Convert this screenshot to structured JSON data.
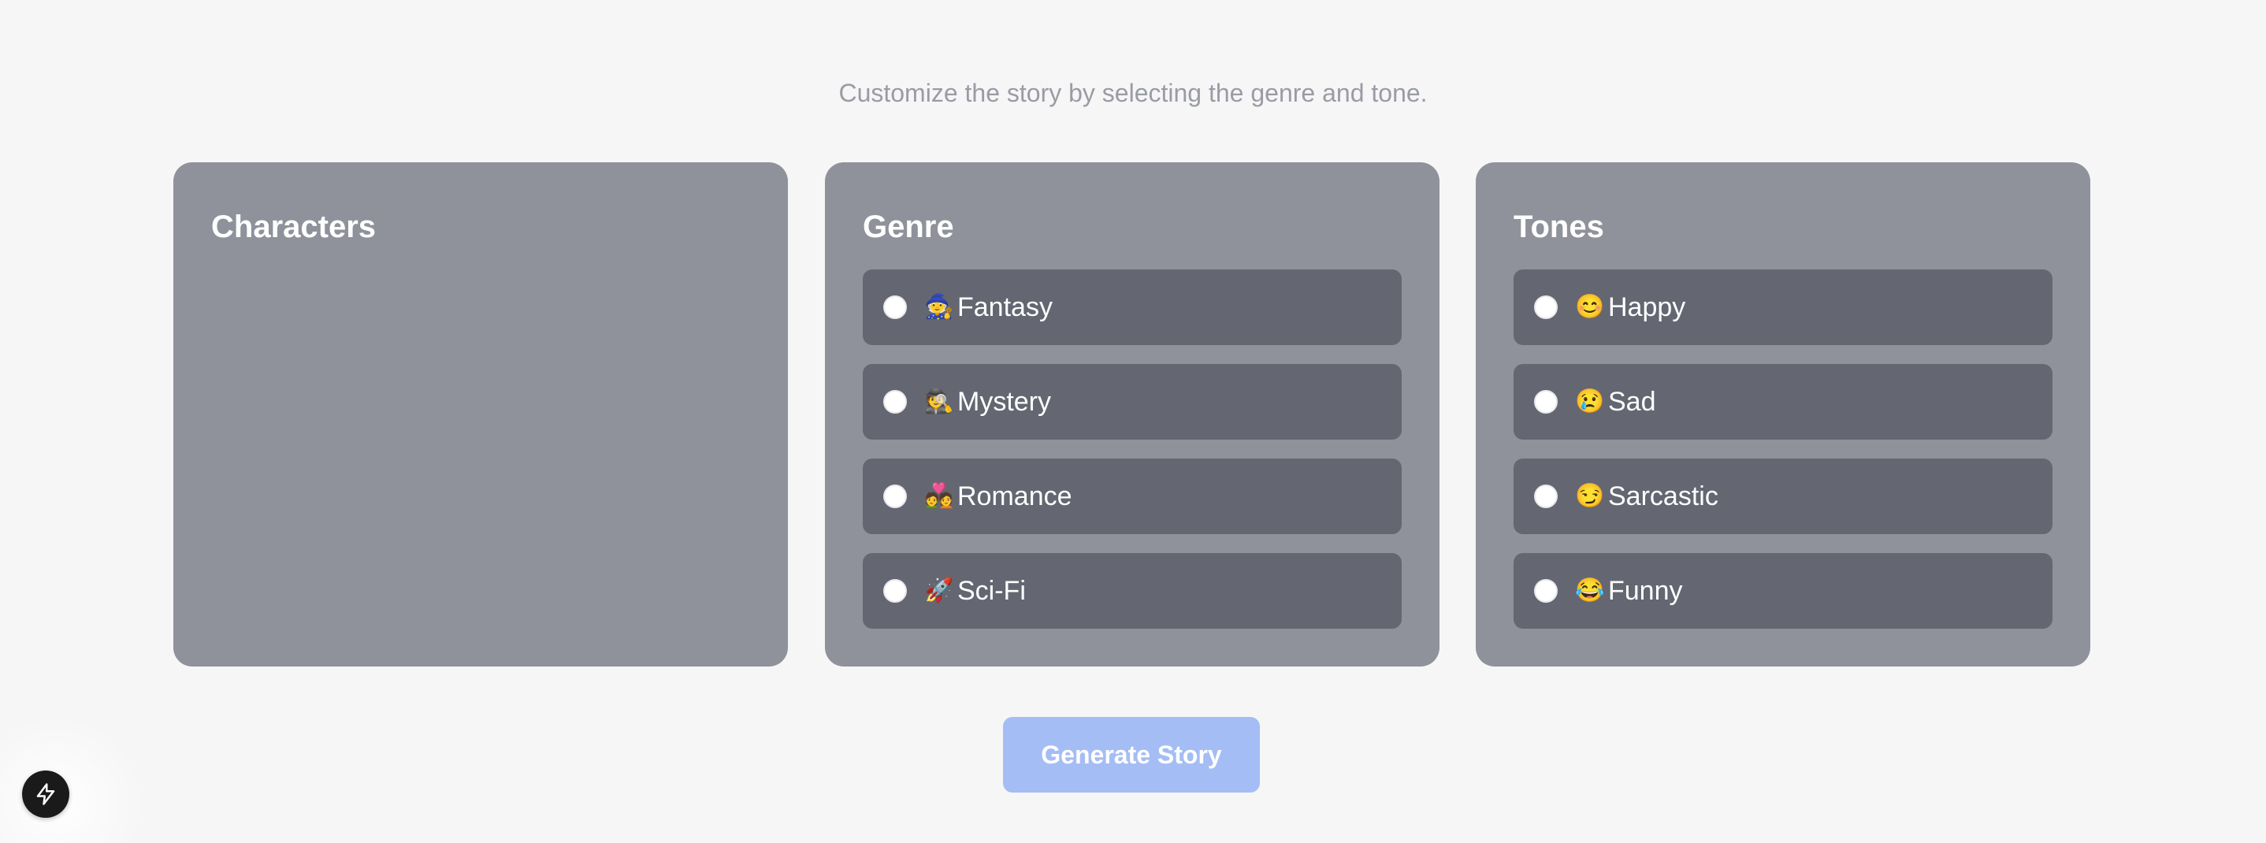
{
  "header": {
    "subtitle": "Customize the story by selecting the genre and tone."
  },
  "panels": {
    "characters": {
      "title": "Characters"
    },
    "genre": {
      "title": "Genre",
      "options": [
        {
          "emoji": "🧙",
          "label": "Fantasy",
          "selected": false
        },
        {
          "emoji": "🕵️",
          "label": "Mystery",
          "selected": false
        },
        {
          "emoji": "💑",
          "label": "Romance",
          "selected": false
        },
        {
          "emoji": "🚀",
          "label": "Sci-Fi",
          "selected": false
        }
      ]
    },
    "tones": {
      "title": "Tones",
      "options": [
        {
          "emoji": "😊",
          "label": "Happy",
          "selected": false
        },
        {
          "emoji": "😢",
          "label": "Sad",
          "selected": false
        },
        {
          "emoji": "😏",
          "label": "Sarcastic",
          "selected": false
        },
        {
          "emoji": "😂",
          "label": "Funny",
          "selected": false
        }
      ]
    }
  },
  "actions": {
    "generate_label": "Generate Story",
    "generate_disabled": true
  },
  "floating": {
    "icon": "lightning-bolt-icon"
  },
  "colors": {
    "page_background": "#f6f6f7",
    "panel_background": "#8f929a",
    "option_background": "#646771",
    "button_background": "#a5bdf5",
    "subtitle_text": "#9a9ca3"
  }
}
